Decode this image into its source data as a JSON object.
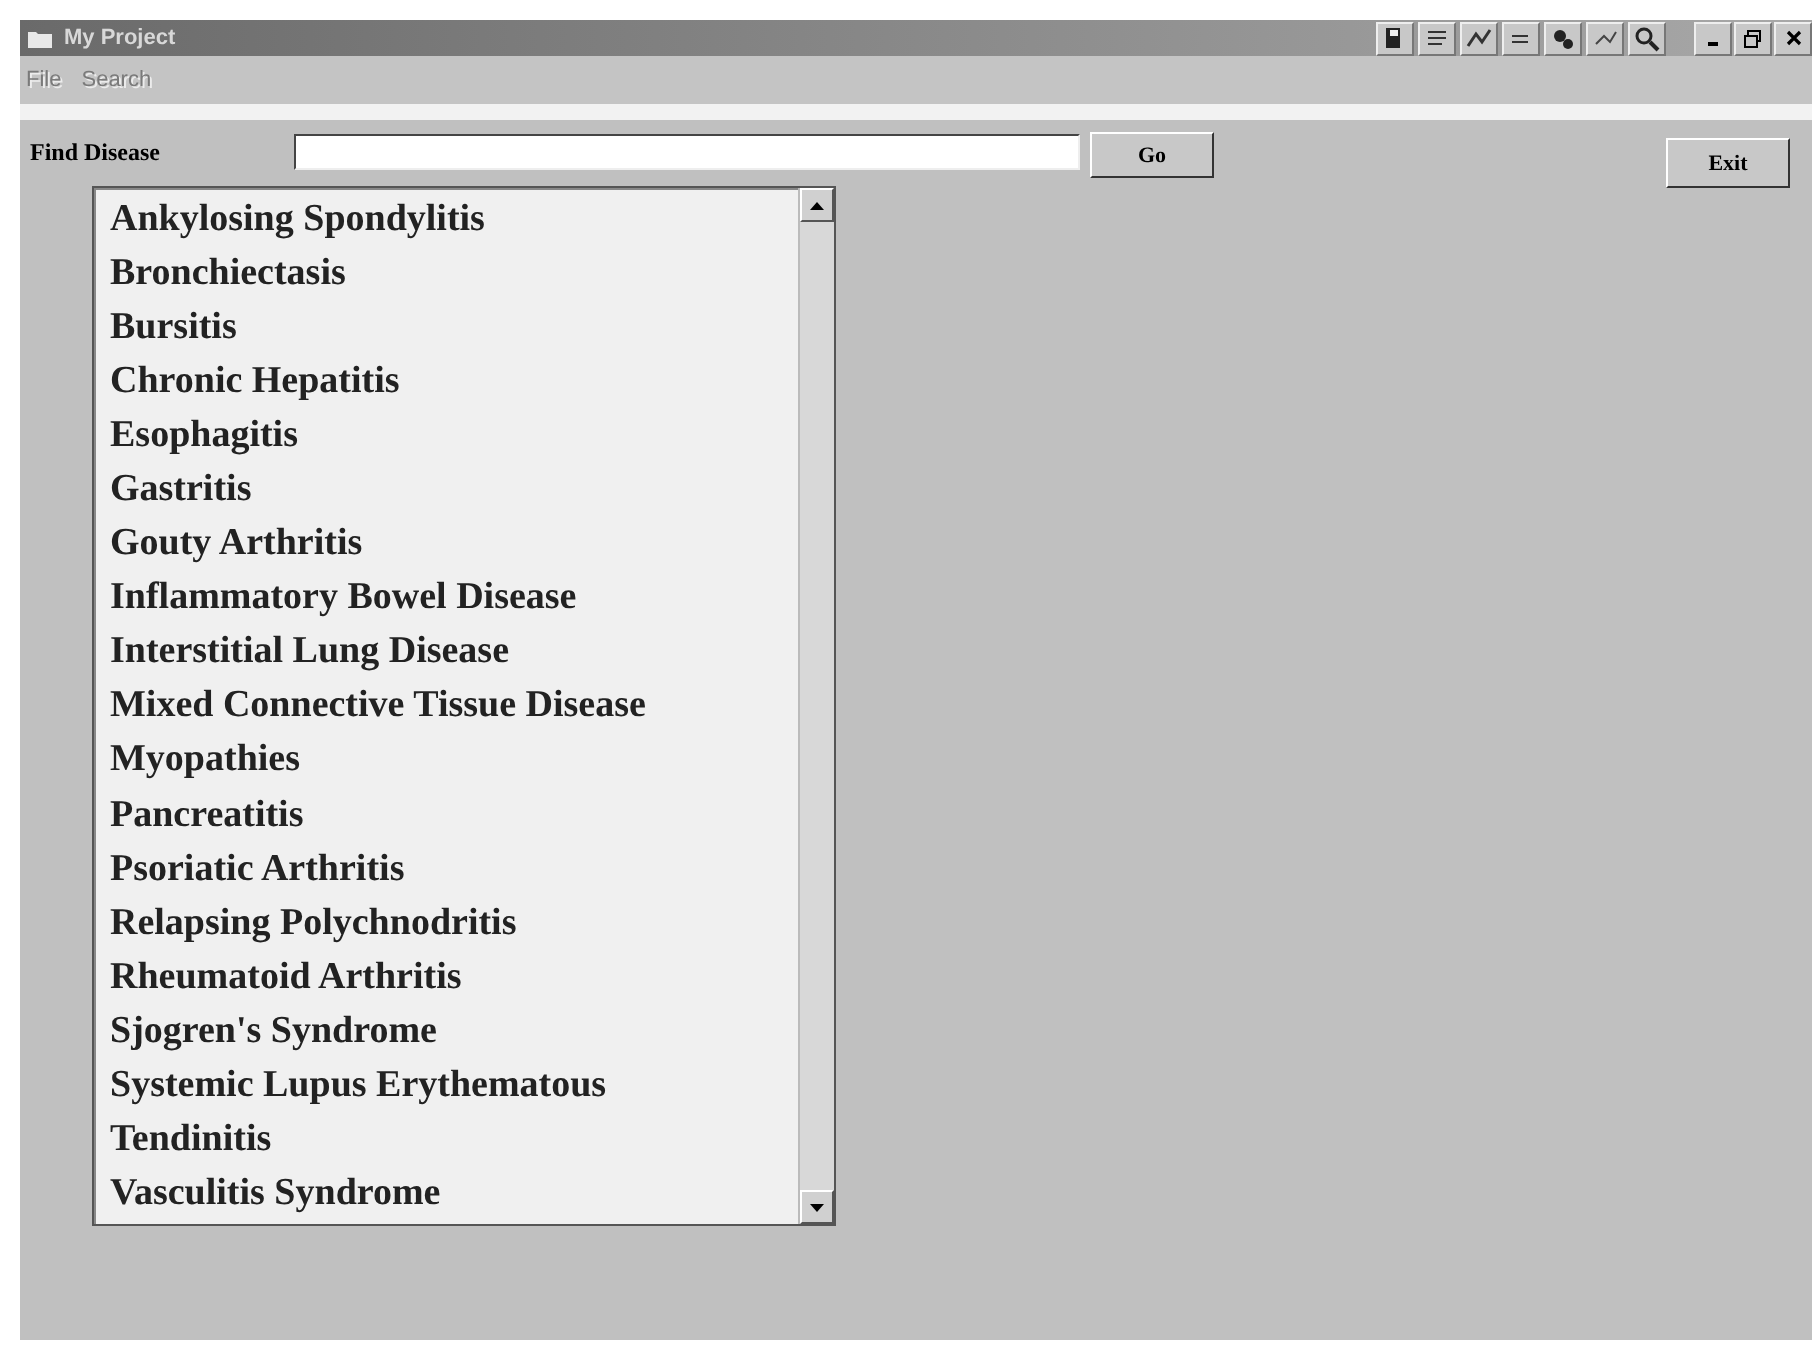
{
  "window": {
    "title": "My Project"
  },
  "menu": [
    {
      "label": "File",
      "disabled": true
    },
    {
      "label": "Search",
      "disabled": true
    }
  ],
  "search": {
    "label": "Find Disease",
    "button": "Go"
  },
  "exit_button": "Exit",
  "diseases": [
    {
      "label": "Ankylosing Spondylitis",
      "selected": false
    },
    {
      "label": "Bronchiectasis",
      "selected": false
    },
    {
      "label": "Bursitis",
      "selected": false
    },
    {
      "label": "Chronic Hepatitis",
      "selected": false
    },
    {
      "label": "Esophagitis",
      "selected": false
    },
    {
      "label": "Gastritis",
      "selected": false
    },
    {
      "label": "Gouty Arthritis",
      "selected": false
    },
    {
      "label": "Inflammatory Bowel Disease",
      "selected": false
    },
    {
      "label": "Interstitial Lung Disease",
      "selected": false
    },
    {
      "label": "Mixed Connective Tissue Disease",
      "selected": false
    },
    {
      "label": "Myopathies",
      "selected": false
    },
    {
      "label": "Pancreatitis",
      "selected": false
    },
    {
      "label": "Psoriatic Arthritis",
      "selected": false
    },
    {
      "label": "Relapsing Polychnodritis",
      "selected": false
    },
    {
      "label": "Rheumatoid Arthritis",
      "selected": false
    },
    {
      "label": "Sjogren's Syndrome",
      "selected": false
    },
    {
      "label": "Systemic Lupus Erythematous",
      "selected": false
    },
    {
      "label": "Tendinitis",
      "selected": false
    },
    {
      "label": "Vasculitis Syndrome",
      "selected": false
    }
  ]
}
